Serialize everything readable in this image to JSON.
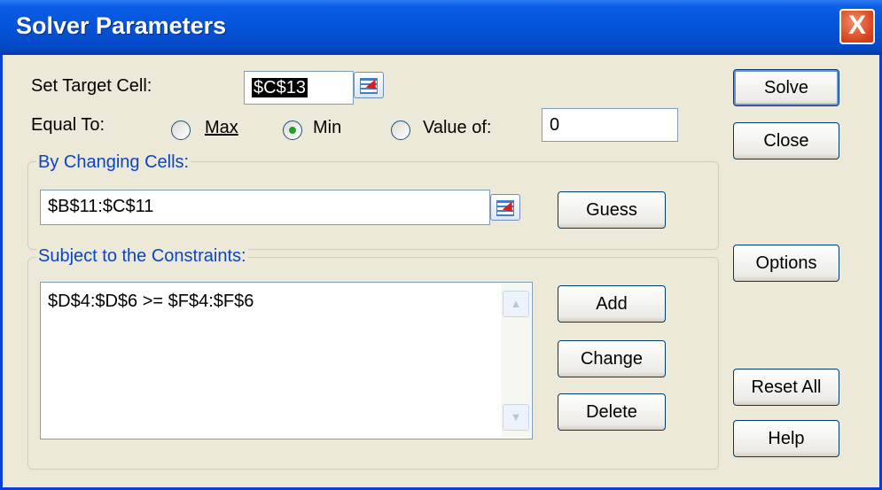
{
  "window": {
    "title": "Solver Parameters",
    "close_glyph": "X"
  },
  "target": {
    "label": "Set Target Cell:",
    "value": "$C$13"
  },
  "equal_to": {
    "label": "Equal To:",
    "max_label": "Max",
    "min_label": "Min",
    "value_of_label": "Value of:",
    "selected": "Min",
    "value_of": "0"
  },
  "changing": {
    "label": "By Changing Cells:",
    "value": "$B$11:$C$11",
    "guess_label": "Guess"
  },
  "constraints": {
    "label": "Subject to the Constraints:",
    "items": [
      "$D$4:$D$6 >= $F$4:$F$6"
    ],
    "add_label": "Add",
    "change_label": "Change",
    "delete_label": "Delete"
  },
  "buttons": {
    "solve": "Solve",
    "close": "Close",
    "options": "Options",
    "reset_all": "Reset All",
    "help": "Help"
  }
}
